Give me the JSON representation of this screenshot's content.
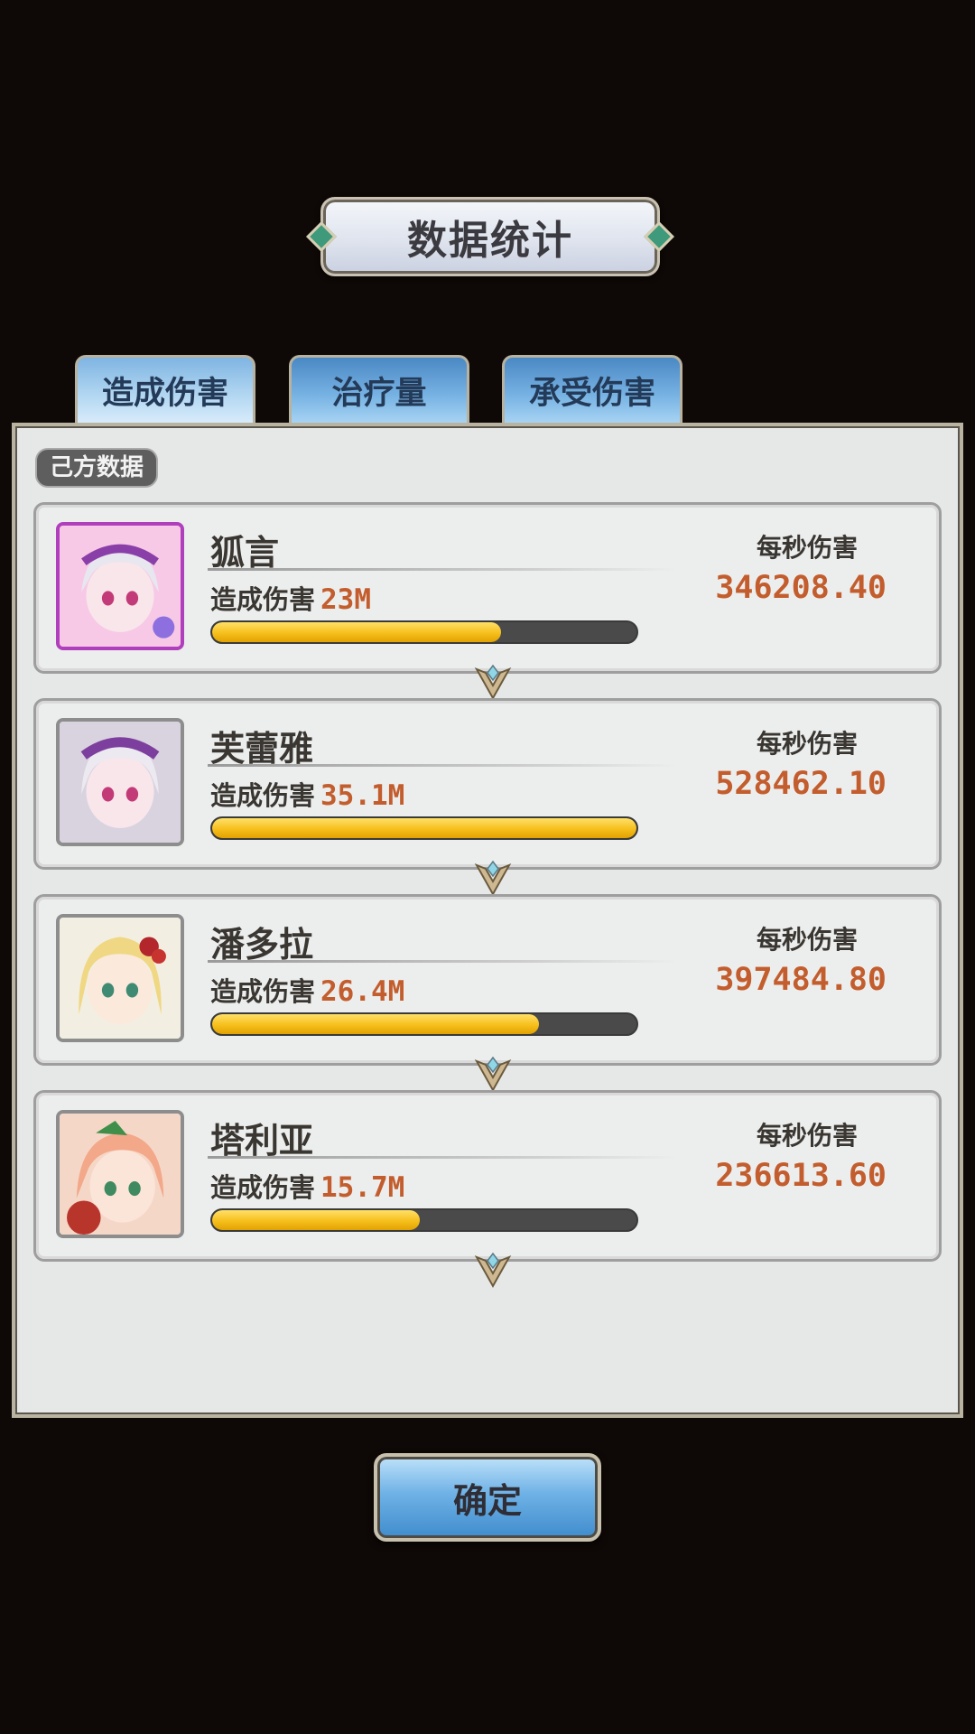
{
  "title": "数据统计",
  "tabs": [
    {
      "label": "造成伤害",
      "active": true
    },
    {
      "label": "治疗量",
      "active": false
    },
    {
      "label": "承受伤害",
      "active": false
    }
  ],
  "section_label": "己方数据",
  "rows": [
    {
      "name": "狐言",
      "damage_label": "造成伤害",
      "damage_value": "23M",
      "dps_label": "每秒伤害",
      "dps_value": "346208.40",
      "bar_fraction": 0.68
    },
    {
      "name": "芙蕾雅",
      "damage_label": "造成伤害",
      "damage_value": "35.1M",
      "dps_label": "每秒伤害",
      "dps_value": "528462.10",
      "bar_fraction": 1.0
    },
    {
      "name": "潘多拉",
      "damage_label": "造成伤害",
      "damage_value": "26.4M",
      "dps_label": "每秒伤害",
      "dps_value": "397484.80",
      "bar_fraction": 0.77
    },
    {
      "name": "塔利亚",
      "damage_label": "造成伤害",
      "damage_value": "15.7M",
      "dps_label": "每秒伤害",
      "dps_value": "236613.60",
      "bar_fraction": 0.49
    }
  ],
  "confirm_label": "确定",
  "colors": {
    "accent_value": "#c35d2d",
    "bar_fill": "#f6bf1c",
    "bar_track": "#4a4a4a"
  }
}
